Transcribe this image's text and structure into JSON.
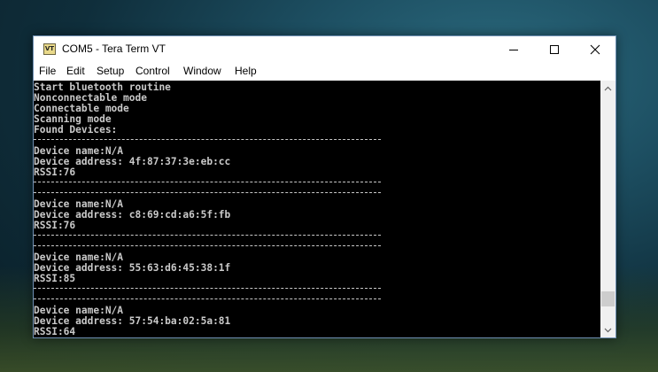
{
  "window": {
    "title": "COM5 - Tera Term VT",
    "icon_text": "VT"
  },
  "menu": {
    "items": [
      "File",
      "Edit",
      "Setup",
      "Control",
      "Window",
      "Help"
    ]
  },
  "terminal": {
    "header_lines": [
      "Start bluetooth routine",
      "Nonconnectable mode",
      "Connectable mode",
      "Scanning mode",
      "Found Devices:"
    ],
    "devices": [
      {
        "name_line": "Device name:N/A",
        "address_line": "Device address: 4f:87:37:3e:eb:cc",
        "rssi_line": "RSSI:76"
      },
      {
        "name_line": "Device name:N/A",
        "address_line": "Device address: c8:69:cd:a6:5f:fb",
        "rssi_line": "RSSI:76"
      },
      {
        "name_line": "Device name:N/A",
        "address_line": "Device address: 55:63:d6:45:38:1f",
        "rssi_line": "RSSI:85"
      },
      {
        "name_line": "Device name:N/A",
        "address_line": "Device address: 57:54:ba:02:5a:81",
        "rssi_line": "RSSI:64"
      }
    ]
  },
  "colors": {
    "terminal_bg": "#000000",
    "terminal_fg": "#c9c9c9",
    "window_border": "#6e8fb3"
  }
}
